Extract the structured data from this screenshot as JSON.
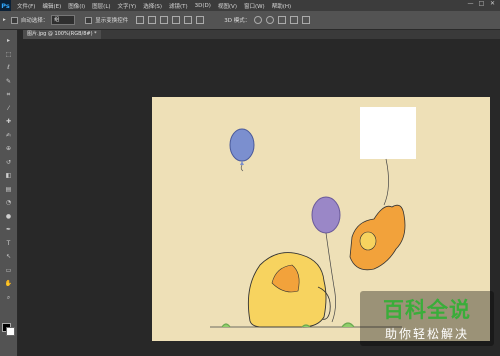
{
  "app": {
    "logo": "Ps"
  },
  "menu": [
    "文件(F)",
    "编辑(E)",
    "图像(I)",
    "图层(L)",
    "文字(Y)",
    "选择(S)",
    "滤镜(T)",
    "3D(D)",
    "视图(V)",
    "窗口(W)",
    "帮助(H)"
  ],
  "window_controls": {
    "minimize": "—",
    "maximize": "□",
    "close": "✕"
  },
  "options": {
    "auto_select_label": "自动选择：",
    "auto_select_value": "组",
    "show_transform_label": "显示变换控件",
    "mode_3d_label": "3D 模式："
  },
  "document": {
    "tab_label": "图片.jpg @ 100%(RGB/8#) *"
  },
  "watermark": {
    "title": "百科全说",
    "subtitle": "助你轻松解决"
  },
  "tools": [
    "move-tool",
    "marquee-tool",
    "lasso-tool",
    "quick-select-tool",
    "crop-tool",
    "eyedropper-tool",
    "healing-tool",
    "brush-tool",
    "clone-stamp-tool",
    "history-brush-tool",
    "eraser-tool",
    "gradient-tool",
    "blur-tool",
    "dodge-tool",
    "pen-tool",
    "type-tool",
    "path-select-tool",
    "shape-tool",
    "hand-tool",
    "zoom-tool"
  ],
  "colors": {
    "canvas_bg": "#eee0b7",
    "balloon_blue": "#7b8fcf",
    "balloon_purple": "#9a87c7",
    "elephant_yellow": "#f7d35f",
    "elephant_orange": "#f2a23b",
    "watermark_green": "#3aad3a"
  }
}
